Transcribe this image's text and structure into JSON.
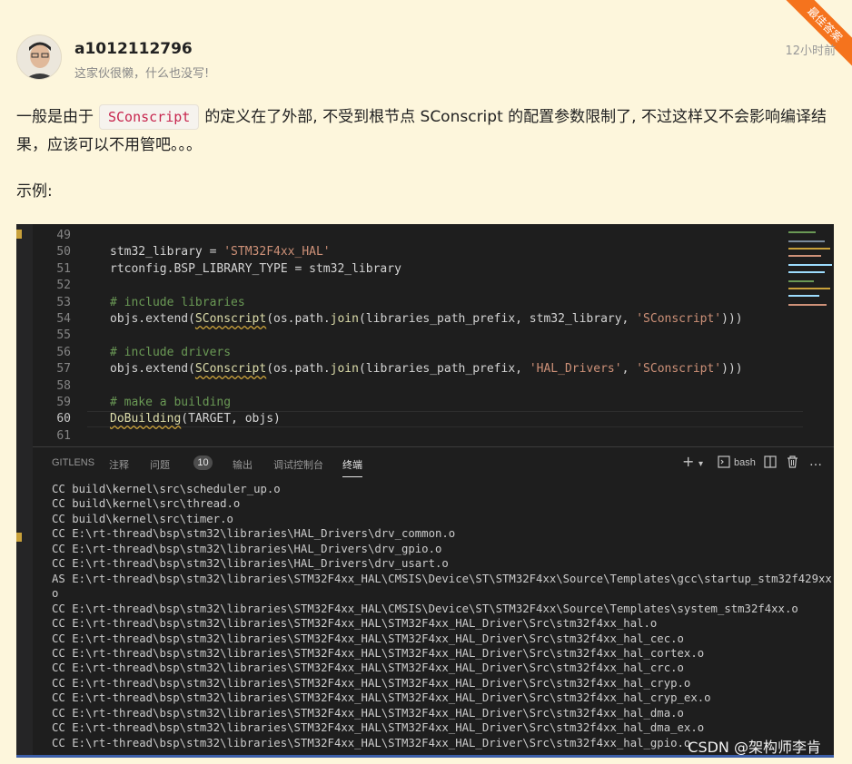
{
  "badge": "最佳答案",
  "author": {
    "name": "a1012112796",
    "bio": "这家伙很懒，什么也没写!",
    "time": "12小时前"
  },
  "answer": {
    "before": "一般是由于",
    "code": "SConscript",
    "after": "的定义在了外部, 不受到根节点 SConscript 的配置参数限制了, 不过这样又不会影响编译结果，应该可以不用管吧。。。",
    "example_label": "示例:"
  },
  "editor": {
    "lines": [
      {
        "n": "49"
      },
      {
        "n": "50",
        "a": "stm32_library = ",
        "b": "'STM32F4xx_HAL'"
      },
      {
        "n": "51",
        "a": "rtconfig.BSP_LIBRARY_TYPE = stm32_library"
      },
      {
        "n": "52"
      },
      {
        "n": "53",
        "c": "# include libraries"
      },
      {
        "n": "54",
        "a": "objs.extend(",
        "w": "SConscript",
        "d": "(os.path.",
        "f": "join",
        "e": "(libraries_path_prefix, stm32_library, ",
        "b": "'SConscript'",
        "g": ")))"
      },
      {
        "n": "55"
      },
      {
        "n": "56",
        "c": "# include drivers"
      },
      {
        "n": "57",
        "a": "objs.extend(",
        "w": "SConscript",
        "d": "(os.path.",
        "f": "join",
        "e": "(libraries_path_prefix, ",
        "b": "'HAL_Drivers'",
        "h": ", ",
        "b2": "'SConscript'",
        "g": ")))"
      },
      {
        "n": "58"
      },
      {
        "n": "59",
        "c": "# make a building"
      },
      {
        "n": "60",
        "w": "DoBuilding",
        "d": "(TARGET, objs)"
      },
      {
        "n": "61"
      }
    ]
  },
  "panel": {
    "tabs": [
      "GITLENS",
      "注释",
      "问题",
      "输出",
      "调试控制台",
      "终端"
    ],
    "problems_count": "10",
    "shell_label": "bash",
    "icons": [
      "plus-icon",
      "chevron-down-icon",
      "terminal-icon",
      "split-icon",
      "trash-icon",
      "ellipsis-icon",
      "chevron-up-icon"
    ]
  },
  "terminal": {
    "lines": [
      "CC build\\kernel\\src\\scheduler_up.o",
      "CC build\\kernel\\src\\thread.o",
      "CC build\\kernel\\src\\timer.o",
      "CC E:\\rt-thread\\bsp\\stm32\\libraries\\HAL_Drivers\\drv_common.o",
      "CC E:\\rt-thread\\bsp\\stm32\\libraries\\HAL_Drivers\\drv_gpio.o",
      "CC E:\\rt-thread\\bsp\\stm32\\libraries\\HAL_Drivers\\drv_usart.o",
      "AS E:\\rt-thread\\bsp\\stm32\\libraries\\STM32F4xx_HAL\\CMSIS\\Device\\ST\\STM32F4xx\\Source\\Templates\\gcc\\startup_stm32f429xx",
      "o",
      "CC E:\\rt-thread\\bsp\\stm32\\libraries\\STM32F4xx_HAL\\CMSIS\\Device\\ST\\STM32F4xx\\Source\\Templates\\system_stm32f4xx.o",
      "CC E:\\rt-thread\\bsp\\stm32\\libraries\\STM32F4xx_HAL\\STM32F4xx_HAL_Driver\\Src\\stm32f4xx_hal.o",
      "CC E:\\rt-thread\\bsp\\stm32\\libraries\\STM32F4xx_HAL\\STM32F4xx_HAL_Driver\\Src\\stm32f4xx_hal_cec.o",
      "CC E:\\rt-thread\\bsp\\stm32\\libraries\\STM32F4xx_HAL\\STM32F4xx_HAL_Driver\\Src\\stm32f4xx_hal_cortex.o",
      "CC E:\\rt-thread\\bsp\\stm32\\libraries\\STM32F4xx_HAL\\STM32F4xx_HAL_Driver\\Src\\stm32f4xx_hal_crc.o",
      "CC E:\\rt-thread\\bsp\\stm32\\libraries\\STM32F4xx_HAL\\STM32F4xx_HAL_Driver\\Src\\stm32f4xx_hal_cryp.o",
      "CC E:\\rt-thread\\bsp\\stm32\\libraries\\STM32F4xx_HAL\\STM32F4xx_HAL_Driver\\Src\\stm32f4xx_hal_cryp_ex.o",
      "CC E:\\rt-thread\\bsp\\stm32\\libraries\\STM32F4xx_HAL\\STM32F4xx_HAL_Driver\\Src\\stm32f4xx_hal_dma.o",
      "CC E:\\rt-thread\\bsp\\stm32\\libraries\\STM32F4xx_HAL\\STM32F4xx_HAL_Driver\\Src\\stm32f4xx_hal_dma_ex.o",
      "CC E:\\rt-thread\\bsp\\stm32\\libraries\\STM32F4xx_HAL\\STM32F4xx_HAL_Driver\\Src\\stm32f4xx_hal_gpio.o"
    ]
  },
  "watermark": "CSDN @架构师李肯"
}
